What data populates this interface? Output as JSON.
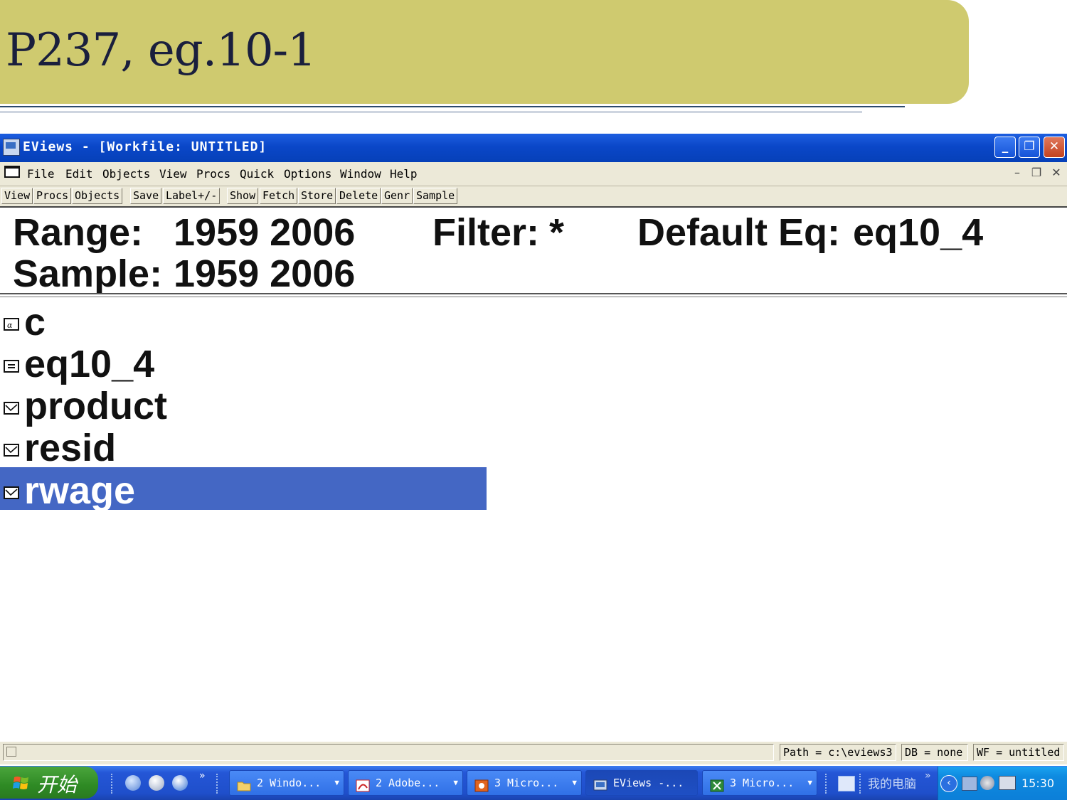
{
  "slide": {
    "title": "P237, eg.10-1"
  },
  "window": {
    "title": "EViews - [Workfile: UNTITLED]",
    "min": "_",
    "max": "❐",
    "close": "✕"
  },
  "menu": [
    "File",
    "Edit",
    "Objects",
    "View",
    "Procs",
    "Quick",
    "Options",
    "Window",
    "Help"
  ],
  "mdi": {
    "min": "–",
    "restore": "❐",
    "close": "✕"
  },
  "toolbar": [
    "View",
    "Procs",
    "Objects",
    "Save",
    "Label+/-",
    "Show",
    "Fetch",
    "Store",
    "Delete",
    "Genr",
    "Sample"
  ],
  "workfile": {
    "range_label": "Range:",
    "range_value": "1959 2006",
    "filter_label": "Filter:",
    "filter_value": "*",
    "default_eq_label": "Default Eq:",
    "default_eq_value": "eq10_4",
    "sample_label": "Sample:",
    "sample_value": "1959 2006"
  },
  "objects": [
    {
      "name": "c",
      "icon": "coefficient-icon"
    },
    {
      "name": "eq10_4",
      "icon": "equation-icon"
    },
    {
      "name": "product",
      "icon": "series-icon"
    },
    {
      "name": "resid",
      "icon": "series-icon"
    },
    {
      "name": "rwage",
      "icon": "series-icon",
      "selected": true
    }
  ],
  "status": {
    "path": "Path = c:\\eviews3",
    "db": "DB = none",
    "wf": "WF = untitled"
  },
  "taskbar": {
    "start": "开始",
    "buttons": [
      {
        "label": "2 Windo...",
        "icon": "folder-icon"
      },
      {
        "label": "2 Adobe...",
        "icon": "acrobat-icon"
      },
      {
        "label": "3 Micro...",
        "icon": "powerpoint-icon"
      },
      {
        "label": "EViews -...",
        "icon": "eviews-icon",
        "active": true
      },
      {
        "label": "3 Micro...",
        "icon": "excel-icon"
      }
    ],
    "my_computer": "我的电脑",
    "clock": "15:30"
  },
  "colors": {
    "banner": "#cfca6f",
    "titlebar": "#0a47c8",
    "selection": "#4467c4",
    "taskbar": "#2456d6"
  }
}
